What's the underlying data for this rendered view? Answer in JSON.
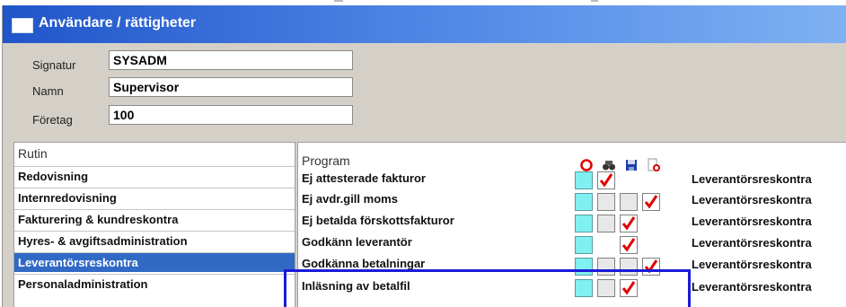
{
  "window": {
    "title": "Användare / rättigheter"
  },
  "form": {
    "signatur": {
      "label": "Signatur",
      "value": "SYSADM"
    },
    "namn": {
      "label": "Namn",
      "value": "Supervisor"
    },
    "foretag": {
      "label": "Företag",
      "value": "100"
    }
  },
  "rutin": {
    "header": "Rutin",
    "items": [
      {
        "label": "Redovisning",
        "selected": false
      },
      {
        "label": "Internredovisning",
        "selected": false
      },
      {
        "label": "Fakturering & kundreskontra",
        "selected": false
      },
      {
        "label": "Hyres- & avgiftsadministration",
        "selected": false
      },
      {
        "label": "Leverantörsreskontra",
        "selected": true
      },
      {
        "label": "Personaladministration",
        "selected": false
      }
    ]
  },
  "program": {
    "header": "Program",
    "column_icons": [
      "red-circle-icon",
      "binoculars-icon",
      "save-disk-icon",
      "document-delete-icon"
    ],
    "rows": [
      {
        "name": "Ej attesterade fakturor",
        "area": "Leverantörsreskontra",
        "perms": [
          true,
          true,
          null,
          null
        ]
      },
      {
        "name": "Ej avdr.gill moms",
        "area": "Leverantörsreskontra",
        "perms": [
          true,
          false,
          false,
          true
        ]
      },
      {
        "name": "Ej betalda förskottsfakturor",
        "area": "Leverantörsreskontra",
        "perms": [
          true,
          false,
          true,
          null
        ]
      },
      {
        "name": "Godkänn leverantör",
        "area": "Leverantörsreskontra",
        "perms": [
          true,
          null,
          true,
          null
        ]
      },
      {
        "name": "Godkänna betalningar",
        "area": "Leverantörsreskontra",
        "perms": [
          true,
          false,
          false,
          true
        ]
      },
      {
        "name": "Inläsning av betalfil",
        "area": "Leverantörsreskontra",
        "perms": [
          true,
          false,
          true,
          null
        ]
      }
    ]
  },
  "colors": {
    "titlebar": "#1f55c8",
    "selected_row": "#316ac5",
    "cyan_box": "#80f0f0",
    "check": "#e00000",
    "highlight": "#1a1ad8"
  }
}
